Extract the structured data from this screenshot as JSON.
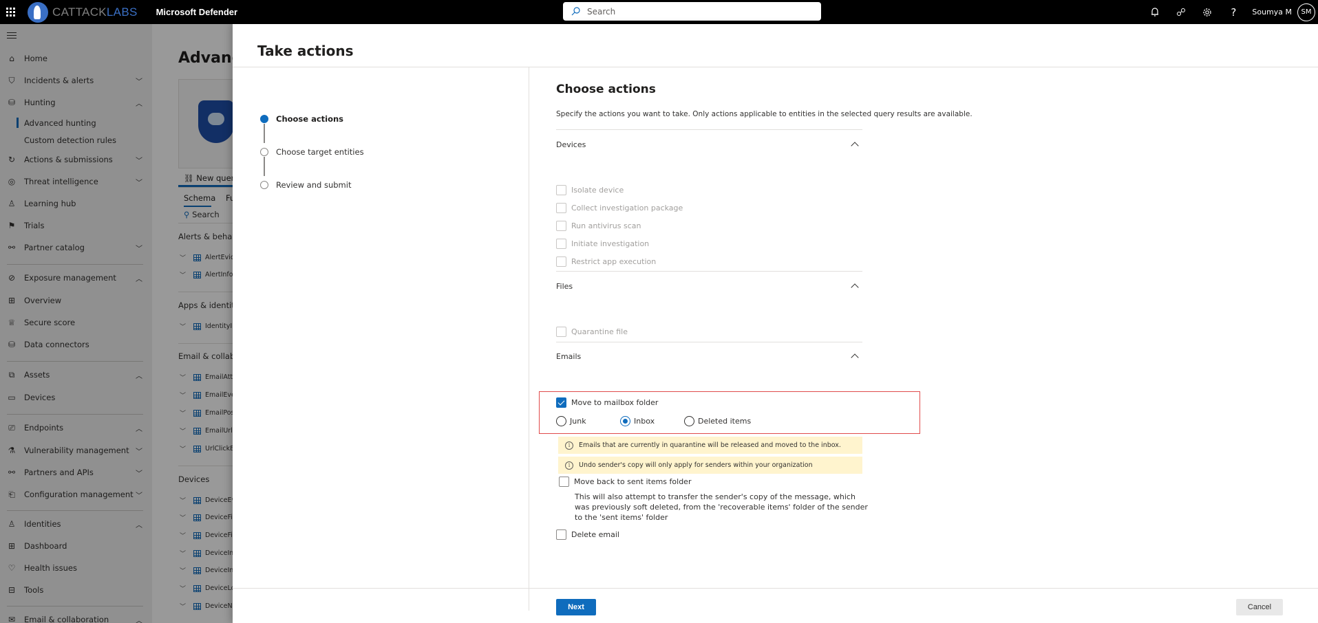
{
  "topbar": {
    "brand_part1": "CATTACK",
    "brand_part2": "LABS",
    "product": "Microsoft Defender",
    "search_placeholder": "Search",
    "icons": [
      "bell-icon",
      "share-icon",
      "gear-icon",
      "help-icon"
    ],
    "user_name": "Soumya M",
    "user_initials": "SM"
  },
  "sidenav": {
    "items": [
      {
        "label": "Home",
        "icon": "home-icon",
        "chevron": ""
      },
      {
        "label": "Incidents & alerts",
        "icon": "shield-alert-icon",
        "chevron": "down"
      },
      {
        "label": "Hunting",
        "icon": "hunting-icon",
        "chevron": "up"
      },
      {
        "label": "Advanced hunting",
        "sub": true,
        "active": true
      },
      {
        "label": "Custom detection rules",
        "sub": true
      },
      {
        "label": "Actions & submissions",
        "icon": "actions-icon",
        "chevron": "down"
      },
      {
        "label": "Threat intelligence",
        "icon": "threat-intel-icon",
        "chevron": "down"
      },
      {
        "label": "Learning hub",
        "icon": "learning-icon",
        "chevron": ""
      },
      {
        "label": "Trials",
        "icon": "trials-icon",
        "chevron": ""
      },
      {
        "label": "Partner catalog",
        "icon": "partner-icon",
        "chevron": "down"
      },
      {
        "label": "Exposure management",
        "icon": "exposure-icon",
        "chevron": "up"
      },
      {
        "label": "Overview",
        "icon": "overview-icon",
        "chevron": ""
      },
      {
        "label": "Secure score",
        "icon": "trophy-icon",
        "chevron": ""
      },
      {
        "label": "Data connectors",
        "icon": "data-connectors-icon",
        "chevron": ""
      },
      {
        "label": "Assets",
        "icon": "assets-icon",
        "chevron": "up"
      },
      {
        "label": "Devices",
        "icon": "laptop-icon",
        "chevron": ""
      },
      {
        "label": "Endpoints",
        "icon": "endpoints-icon",
        "chevron": "up"
      },
      {
        "label": "Vulnerability management",
        "icon": "vulnerability-icon",
        "chevron": "down"
      },
      {
        "label": "Partners and APIs",
        "icon": "partners-api-icon",
        "chevron": "down"
      },
      {
        "label": "Configuration management",
        "icon": "config-icon",
        "chevron": "down"
      },
      {
        "label": "Identities",
        "icon": "person-icon",
        "chevron": "up"
      },
      {
        "label": "Dashboard",
        "icon": "dashboard-icon",
        "chevron": ""
      },
      {
        "label": "Health issues",
        "icon": "heart-icon",
        "chevron": ""
      },
      {
        "label": "Tools",
        "icon": "toolbox-icon",
        "chevron": ""
      },
      {
        "label": "Email & collaboration",
        "icon": "mail-icon",
        "chevron": "up"
      }
    ]
  },
  "background": {
    "title": "Advanced hunting",
    "new_query_tab": "New query",
    "tabs": [
      "Schema",
      "Functions"
    ],
    "search": "Search",
    "groups": [
      {
        "name": "Alerts & behaviors",
        "tables": [
          "AlertEvidence",
          "AlertInfo"
        ]
      },
      {
        "name": "Apps & identities",
        "tables": [
          "IdentityInfo"
        ]
      },
      {
        "name": "Email & collaboration",
        "tables": [
          "EmailAttachmentInfo",
          "EmailEvents",
          "EmailPostDeliveryEvents",
          "EmailUrlInfo",
          "UrlClickEvents"
        ]
      },
      {
        "name": "Devices",
        "tables": [
          "DeviceEvents",
          "DeviceFileCertificateInfo",
          "DeviceFileEvents",
          "DeviceImageLoadEvents",
          "DeviceInfo",
          "DeviceLogonEvents",
          "DeviceNetworkEvents"
        ]
      }
    ]
  },
  "panel": {
    "title": "Take actions",
    "steps": [
      {
        "label": "Choose actions",
        "active": true
      },
      {
        "label": "Choose target entities",
        "active": false
      },
      {
        "label": "Review and submit",
        "active": false
      }
    ],
    "content": {
      "title": "Choose actions",
      "description": "Specify the actions you want to take. Only actions applicable to entities in the selected query results are available.",
      "sections": {
        "devices": {
          "title": "Devices",
          "actions": [
            {
              "label": "Isolate device",
              "checked": false,
              "disabled": true
            },
            {
              "label": "Collect investigation package",
              "checked": false,
              "disabled": true
            },
            {
              "label": "Run antivirus scan",
              "checked": false,
              "disabled": true
            },
            {
              "label": "Initiate investigation",
              "checked": false,
              "disabled": true
            },
            {
              "label": "Restrict app execution",
              "checked": false,
              "disabled": true
            }
          ]
        },
        "files": {
          "title": "Files",
          "actions": [
            {
              "label": "Quarantine file",
              "checked": false,
              "disabled": true
            }
          ]
        },
        "emails": {
          "title": "Emails",
          "move_to_mailbox": {
            "label": "Move to mailbox folder",
            "checked": true
          },
          "folders": [
            {
              "label": "Junk",
              "selected": false
            },
            {
              "label": "Inbox",
              "selected": true
            },
            {
              "label": "Deleted items",
              "selected": false
            }
          ],
          "quarantine_info": "Emails that are currently in quarantine will be released and moved to the inbox.",
          "sender_info": "Undo sender's copy will only apply for senders within your organization",
          "move_back": {
            "label": "Move back to sent items folder",
            "checked": false
          },
          "move_back_desc": "This will also attempt to transfer the sender's copy of the message, which was previously soft deleted, from the 'recoverable items' folder of the sender to the 'sent items' folder",
          "delete_email": {
            "label": "Delete email",
            "checked": false
          }
        }
      }
    },
    "footer": {
      "next_label": "Next",
      "cancel_label": "Cancel"
    }
  },
  "colors": {
    "accent": "#0f6cbd",
    "info_bg": "#fff4ce",
    "highlight_border": "#e04a4a",
    "topbar_bg": "#000000"
  }
}
